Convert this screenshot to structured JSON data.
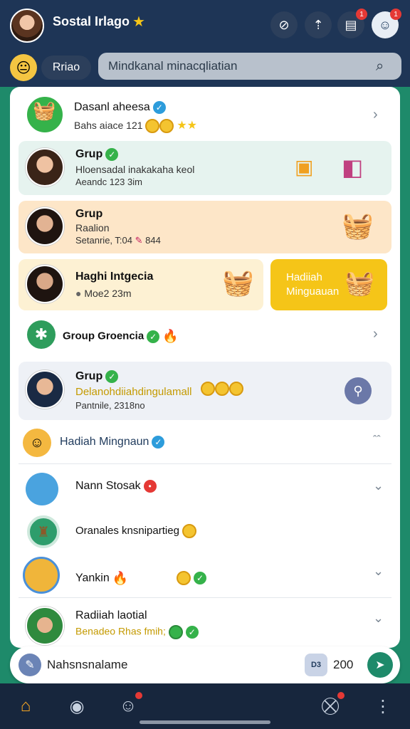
{
  "header": {
    "title": "Sostal Irlago",
    "notifications": [
      {
        "icon": "mute-icon",
        "badge": ""
      },
      {
        "icon": "upload-icon",
        "badge": ""
      },
      {
        "icon": "inbox-icon",
        "badge": "1"
      },
      {
        "icon": "bot-face-icon",
        "badge": "1"
      }
    ]
  },
  "search": {
    "pill_label": "Rriao",
    "placeholder": "Mindkanal minacqliatian"
  },
  "rows": {
    "r1": {
      "title": "Dasanl aheesa",
      "sub": "Bahs aiace 121"
    },
    "r2": {
      "title": "Grup",
      "sub": "Hloensadal inakakaha keol",
      "meta": "Aeandc 123 3im"
    },
    "r3": {
      "title": "Grup",
      "sub": "Raalion",
      "meta": "Setanrie, T:04",
      "meta2": "844"
    },
    "r4": {
      "title": "Haghi Intgecia",
      "meta": "Moe2 23m",
      "promo_line1": "Hadiiah",
      "promo_line2": "Minguauan"
    },
    "r5": {
      "title": "Group Groencia"
    },
    "r6": {
      "title": "Grup",
      "sub": "Delanohdiiahdingulamall",
      "meta": "Pantnile, 2318no"
    },
    "r7": {
      "title": "Hadiah Mingnaun"
    },
    "r8": {
      "title": "Nann Stosak"
    },
    "r9": {
      "title": "Oranales knsnipartieg"
    },
    "r10": {
      "title": "Yankin"
    },
    "r11": {
      "title": "Radiiah laotial",
      "sub": "Benadeo Rhas fmih;"
    }
  },
  "composer": {
    "text": "Nahsnsnalame",
    "badge_label": "D3",
    "count": "200"
  },
  "nav": {
    "items": [
      "home-icon",
      "profile-icon",
      "chat-icon",
      "cart-icon",
      "more-icon"
    ]
  },
  "colors": {
    "header_bg": "#1e3556",
    "accent_green": "#1e8a6a",
    "promo_yellow": "#f5c518"
  }
}
